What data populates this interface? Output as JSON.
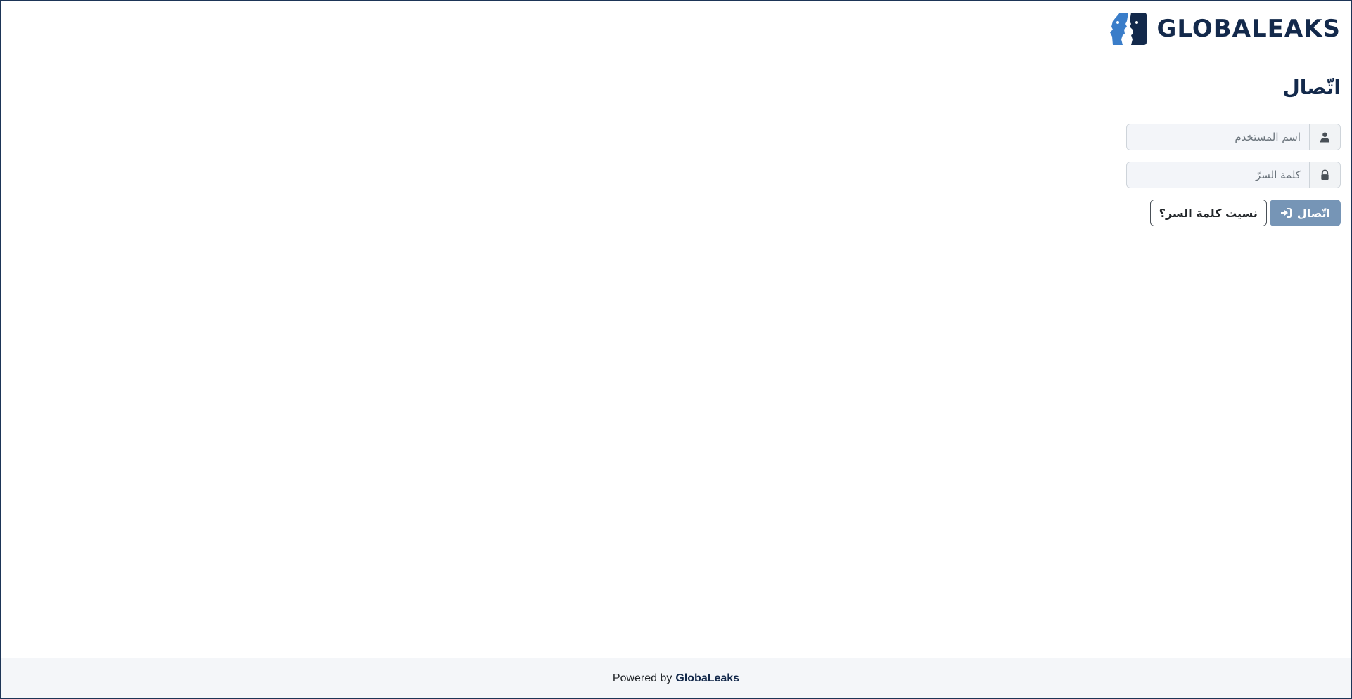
{
  "header": {
    "logo_text": "GLOBALEAKS",
    "logo_icon": "globaleaks-faces-logo"
  },
  "login": {
    "title": "اتّصال",
    "username_placeholder": "اسم المستخدم",
    "username_icon": "user-icon",
    "password_placeholder": "كلمة السرّ",
    "password_icon": "lock-icon",
    "login_button_label": "اتّصال",
    "login_button_icon": "sign-in-icon",
    "forgot_button_label": "نسيت كلمة السر؟"
  },
  "footer": {
    "powered_by": "Powered by",
    "brand": "GlobaLeaks"
  },
  "colors": {
    "brand_dark": "#13294b",
    "brand_light": "#3a7dc9",
    "login_button": "#7695b6"
  }
}
